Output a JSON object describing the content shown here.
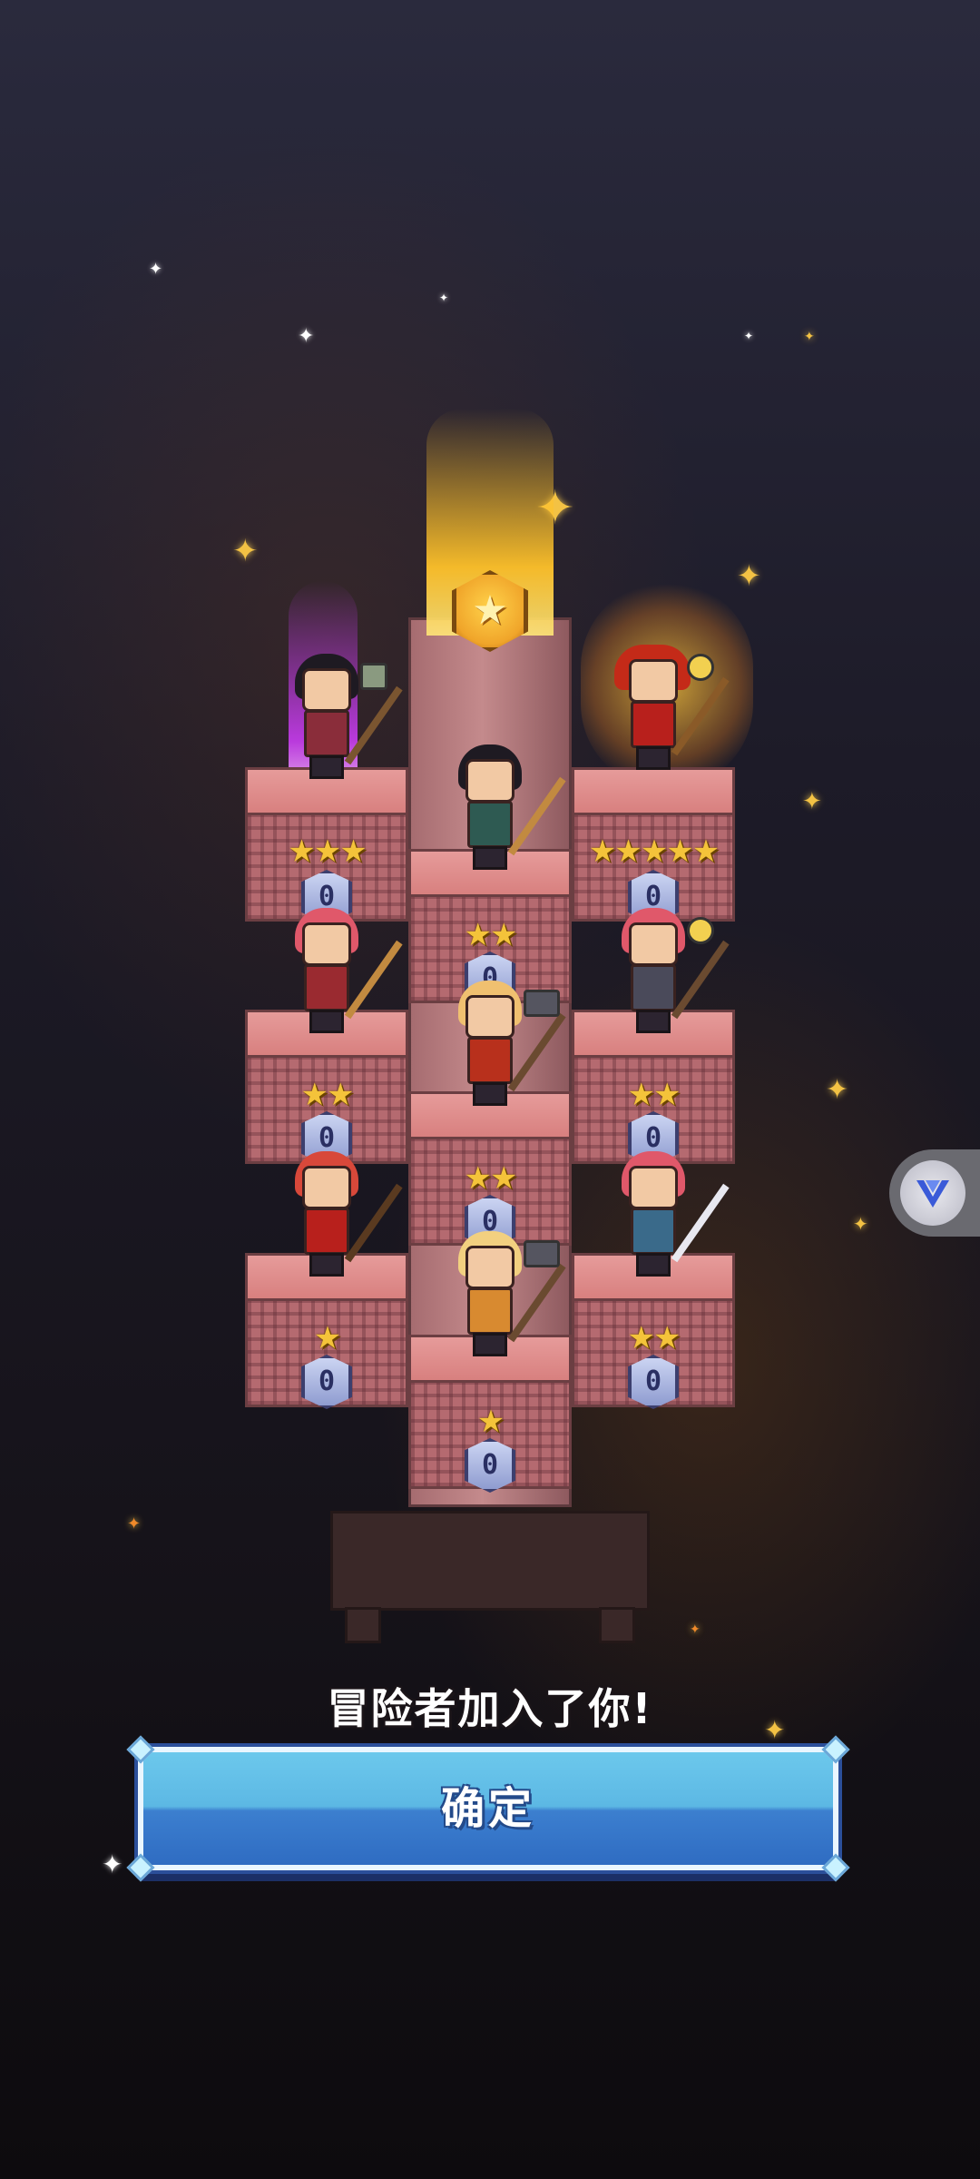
{
  "message": "冒险者加入了你!",
  "confirm_button": {
    "label": "确定"
  },
  "floating_button": {
    "icon": "v-logo-icon"
  },
  "medal": {
    "icon": "star-medal-icon",
    "glyph": "★"
  },
  "colors": {
    "button_blue": "#3c7fcf",
    "star_gold": "#f4c33a",
    "purple_beam": "#c83cf0",
    "gold_beam": "#ffc22a"
  },
  "heroes": [
    {
      "name": "axe-warrior",
      "stars": "★★★",
      "level": "0"
    },
    {
      "name": "archer-dark-hair",
      "stars": "★★",
      "level": "0"
    },
    {
      "name": "red-hair-staff-mage",
      "stars": "★★★★★",
      "level": "0"
    },
    {
      "name": "pink-hair-archer",
      "stars": "★★",
      "level": "0"
    },
    {
      "name": "blonde-hammer",
      "stars": "★★",
      "level": "0"
    },
    {
      "name": "pink-hair-mace",
      "stars": "★★",
      "level": "0"
    },
    {
      "name": "red-ponytail-staff",
      "stars": "★",
      "level": "0"
    },
    {
      "name": "blonde-girl-hammer",
      "stars": "★",
      "level": "0"
    },
    {
      "name": "pink-hair-sword",
      "stars": "★★",
      "level": "0"
    }
  ]
}
